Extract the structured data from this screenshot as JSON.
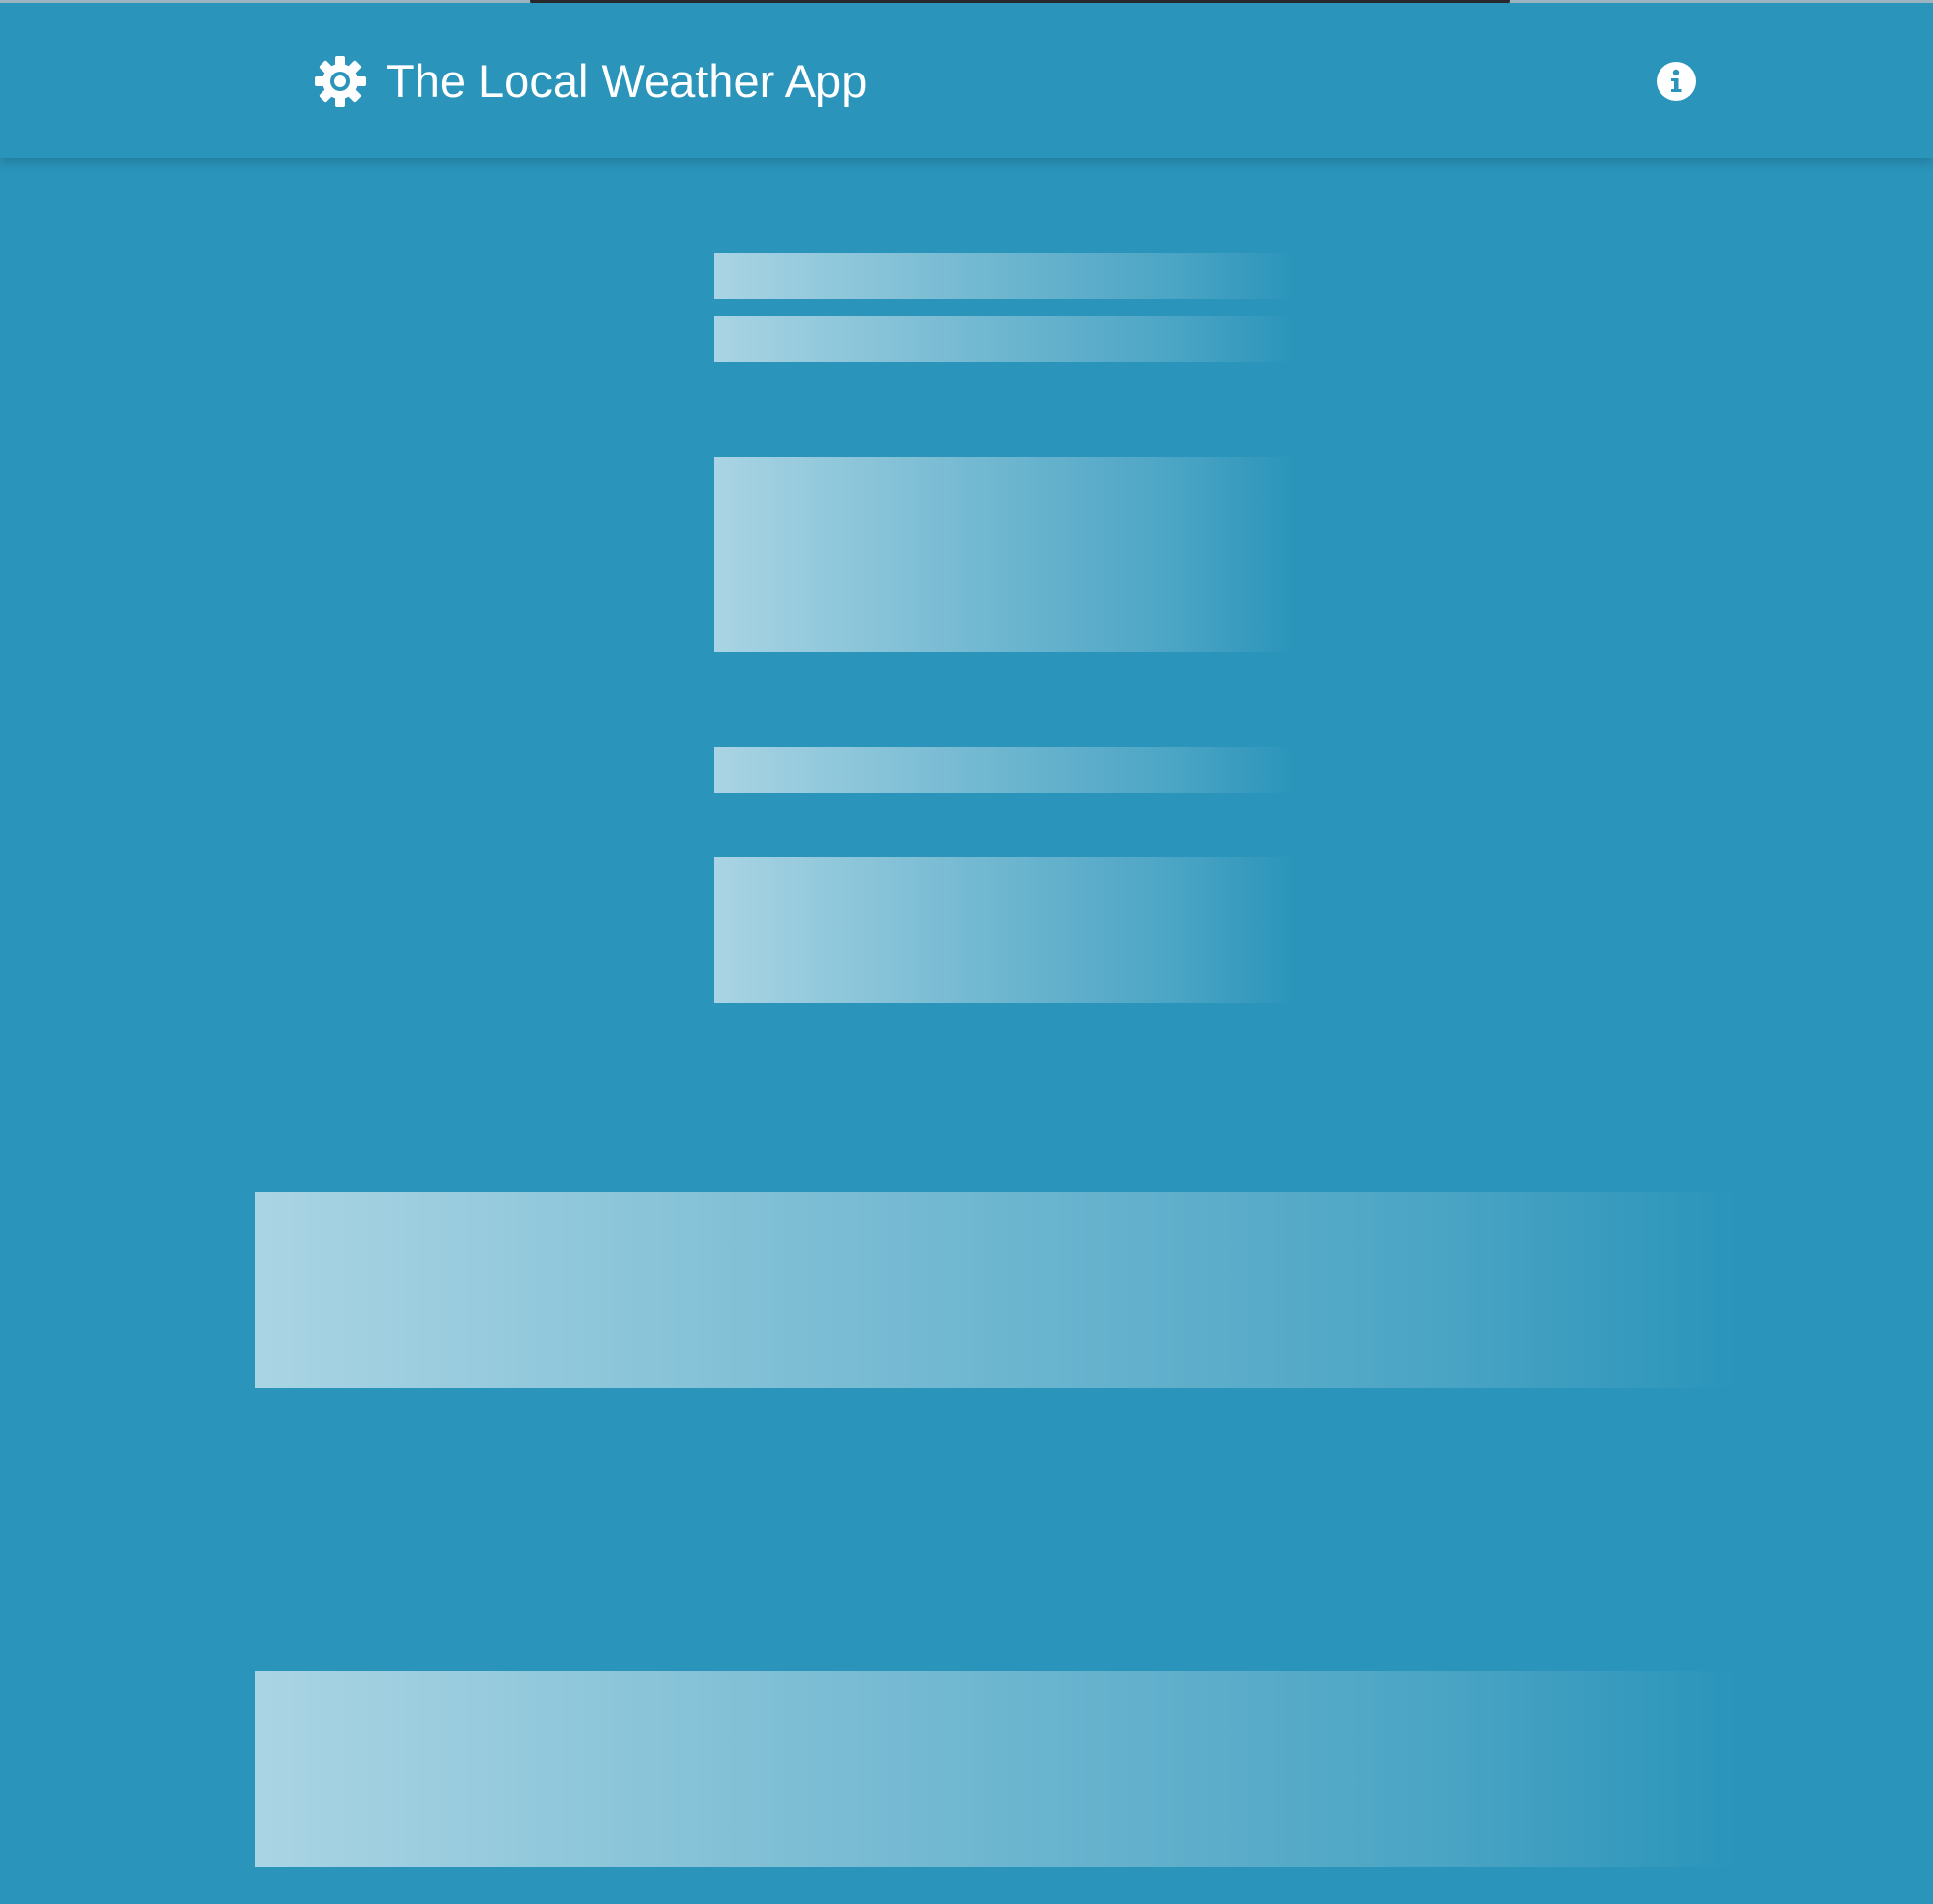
{
  "appbar": {
    "title": "The Local Weather App",
    "brand_icon": "gear-icon",
    "info_icon": "info-icon"
  },
  "colors": {
    "background": "#2a94ba",
    "text": "#ffffff",
    "skeleton_highlight": "#ffffff"
  },
  "content": {
    "state": "loading",
    "skeleton_placeholders": 7
  }
}
